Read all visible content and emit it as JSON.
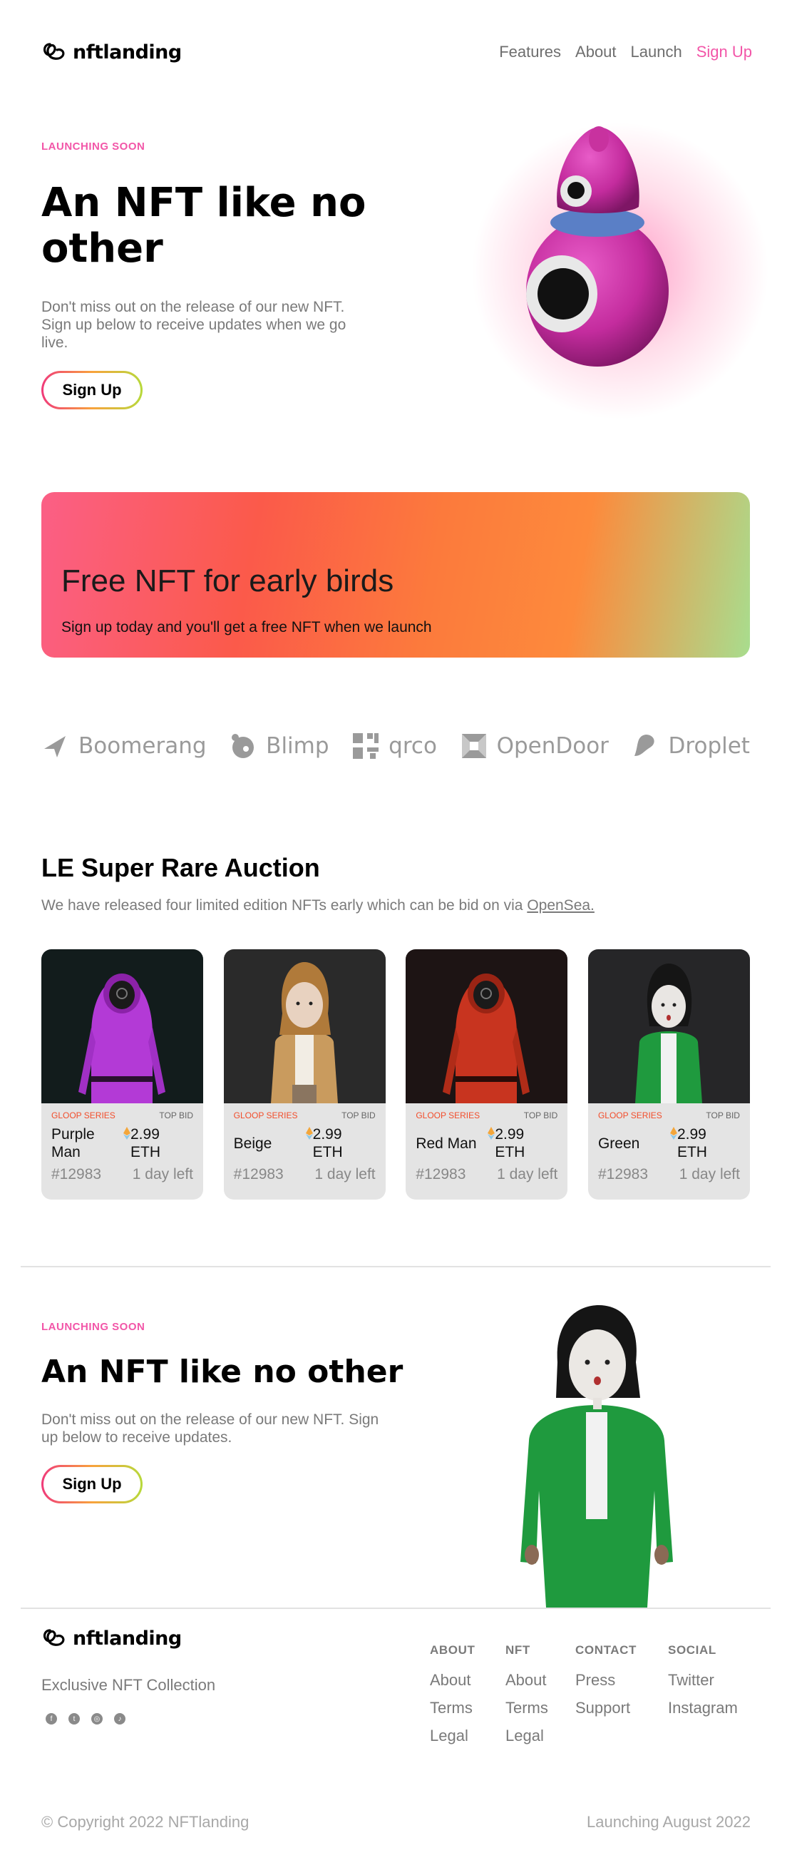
{
  "brand": {
    "name": "nftlanding",
    "accent": "#f256a8"
  },
  "nav": {
    "items": [
      {
        "label": "Features",
        "accent": false
      },
      {
        "label": "About",
        "accent": false
      },
      {
        "label": "Launch",
        "accent": false
      },
      {
        "label": "Sign Up",
        "accent": true
      }
    ]
  },
  "hero": {
    "eyebrow": "LAUNCHING SOON",
    "title": "An NFT like no other",
    "text": "Don't miss out on the release of our new NFT. Sign up below to receive updates when we go live.",
    "button": "Sign Up"
  },
  "promo": {
    "title": "Free NFT for early birds",
    "subtitle": "Sign up today and you'll get a free NFT when we launch"
  },
  "brands": [
    "Boomerang",
    "Blimp",
    "qrco",
    "OpenDoor",
    "Droplet"
  ],
  "auction": {
    "title": "LE Super Rare Auction",
    "subtitle_prefix": "We have released four limited edition NFTs early which can be bid on via",
    "subtitle_link": "OpenSea.",
    "cards": [
      {
        "series": "GLOOP SERIES",
        "bid_label": "TOP BID",
        "name": "Purple Man",
        "price": "2.99 ETH",
        "id": "#12983",
        "time": "1 day left",
        "bg": "#121c1c",
        "outfit": "#b33ad6"
      },
      {
        "series": "GLOOP SERIES",
        "bid_label": "TOP BID",
        "name": "Beige",
        "price": "2.99 ETH",
        "id": "#12983",
        "time": "1 day left",
        "bg": "#2a2a2a",
        "outfit": "#c99b5e"
      },
      {
        "series": "GLOOP SERIES",
        "bid_label": "TOP BID",
        "name": "Red Man",
        "price": "2.99 ETH",
        "id": "#12983",
        "time": "1 day left",
        "bg": "#1d1414",
        "outfit": "#c8341f"
      },
      {
        "series": "GLOOP SERIES",
        "bid_label": "TOP BID",
        "name": "Green",
        "price": "2.99 ETH",
        "id": "#12983",
        "time": "1 day left",
        "bg": "#262628",
        "outfit": "#1f9a3e"
      }
    ]
  },
  "hero2": {
    "eyebrow": "LAUNCHING SOON",
    "title": "An NFT like no other",
    "text": "Don't miss out on the release of our new NFT. Sign up below to receive updates.",
    "button": "Sign Up"
  },
  "footer": {
    "tagline": "Exclusive NFT Collection",
    "socials": [
      "facebook-icon",
      "twitter-icon",
      "instagram-icon",
      "tiktok-icon"
    ],
    "columns": [
      {
        "heading": "ABOUT",
        "links": [
          "About",
          "Terms",
          "Legal"
        ]
      },
      {
        "heading": "NFT",
        "links": [
          "About",
          "Terms",
          "Legal"
        ]
      },
      {
        "heading": "CONTACT",
        "links": [
          "Press",
          "Support"
        ]
      },
      {
        "heading": "SOCIAL",
        "links": [
          "Twitter",
          "Instagram"
        ]
      }
    ],
    "copyright": "© Copyright 2022 NFTlanding",
    "launch_date": "Launching August 2022"
  }
}
